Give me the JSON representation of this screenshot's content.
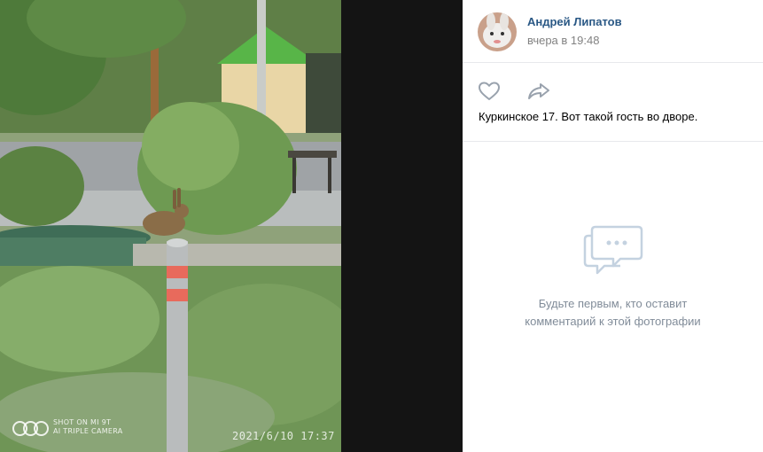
{
  "photo": {
    "watermark_line1": "SHOT ON MI 9T",
    "watermark_line2": "AI TRIPLE CAMERA",
    "timestamp": "2021/6/10  17:37"
  },
  "post": {
    "author": "Андрей Липатов",
    "date": "вчера в 19:48",
    "caption": "Куркинское 17. Вот такой гость во дворе."
  },
  "actions": {
    "like_icon": "heart-icon",
    "share_icon": "share-arrow-icon"
  },
  "comments": {
    "empty_line1": "Будьте первым, кто оставит",
    "empty_line2": "комментарий к этой фотографии"
  },
  "colors": {
    "link": "#2a5885",
    "muted": "#828282",
    "icon": "#99a2ad",
    "empty_text": "#818c99",
    "photo_bg": "#141414"
  }
}
